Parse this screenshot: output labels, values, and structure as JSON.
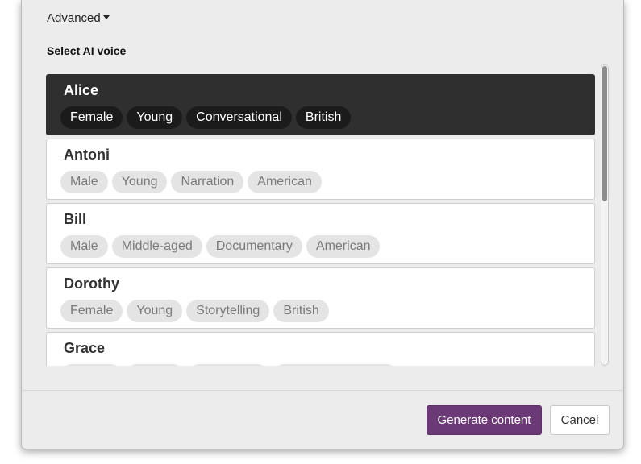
{
  "advanced": {
    "label": "Advanced",
    "icon": "caret-down-icon"
  },
  "section_title": "Select AI voice",
  "voices": [
    {
      "name": "Alice",
      "selected": true,
      "tags": [
        "Female",
        "Young",
        "Conversational",
        "British"
      ]
    },
    {
      "name": "Antoni",
      "selected": false,
      "tags": [
        "Male",
        "Young",
        "Narration",
        "American"
      ]
    },
    {
      "name": "Bill",
      "selected": false,
      "tags": [
        "Male",
        "Middle-aged",
        "Documentary",
        "American"
      ]
    },
    {
      "name": "Dorothy",
      "selected": false,
      "tags": [
        "Female",
        "Young",
        "Storytelling",
        "British"
      ]
    },
    {
      "name": "Grace",
      "selected": false,
      "tags": []
    }
  ],
  "footer": {
    "generate_label": "Generate content",
    "cancel_label": "Cancel"
  },
  "colors": {
    "selected_card": "#2f2f2f",
    "primary_button": "#6b3a76",
    "dialog_background": "#ececec"
  }
}
